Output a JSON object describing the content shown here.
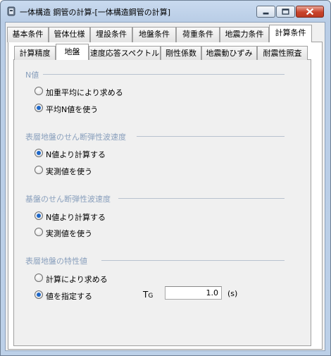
{
  "window": {
    "title": "一体構造 鋼管の計算-[一体構造鋼管の計算]",
    "controls": {
      "minimize": "minimize",
      "maximize": "maximize",
      "close": "close"
    }
  },
  "main_tabs": [
    {
      "label": "基本条件",
      "active": false
    },
    {
      "label": "管体仕様",
      "active": false
    },
    {
      "label": "埋設条件",
      "active": false
    },
    {
      "label": "地盤条件",
      "active": false
    },
    {
      "label": "荷重条件",
      "active": false
    },
    {
      "label": "地震力条件",
      "active": false
    },
    {
      "label": "計算条件",
      "active": true
    }
  ],
  "sub_tabs": [
    {
      "label": "計算精度",
      "active": false
    },
    {
      "label": "地盤",
      "active": true
    },
    {
      "label": "速度応答スペクトル",
      "active": false
    },
    {
      "label": "剛性係数",
      "active": false
    },
    {
      "label": "地震動ひずみ",
      "active": false
    },
    {
      "label": "耐震性照査",
      "active": false
    }
  ],
  "groups": {
    "n_value": {
      "title": "N値",
      "options": [
        {
          "label": "加重平均により求める",
          "checked": false
        },
        {
          "label": "平均N値を使う",
          "checked": true
        }
      ]
    },
    "surface_shear_wave": {
      "title": "表層地盤のせん断弾性波速度",
      "options": [
        {
          "label": "N値より計算する",
          "checked": true
        },
        {
          "label": "実測値を使う",
          "checked": false
        }
      ]
    },
    "base_shear_wave": {
      "title": "基盤のせん断弾性波速度",
      "options": [
        {
          "label": "N値より計算する",
          "checked": true
        },
        {
          "label": "実測値を使う",
          "checked": false
        }
      ]
    },
    "characteristic_value": {
      "title": "表層地盤の特性値",
      "options": [
        {
          "label": "計算により求める",
          "checked": false
        },
        {
          "label": "値を指定する",
          "checked": true
        }
      ],
      "tg": {
        "label": "T",
        "subscript": "G",
        "value": "1.0",
        "unit": "(s)"
      }
    }
  },
  "colors": {
    "group_title": "#8aa0bd",
    "radio_selected": "#1d67c8",
    "close_button": "#c9432b"
  }
}
